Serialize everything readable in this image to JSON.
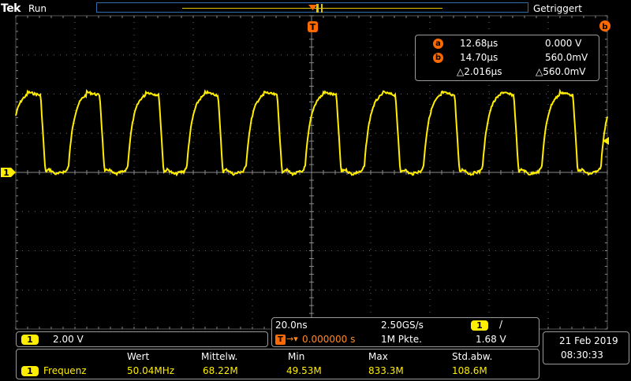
{
  "header": {
    "brand": "Tek",
    "run_state": "Run",
    "trigger_state": "Getriggert"
  },
  "markers": {
    "trigger_marker": "T",
    "cursor_a_marker": "a",
    "cursor_b_marker": "b",
    "channel_marker": "1"
  },
  "cursors": {
    "a_label": "a",
    "a_time": "12.68µs",
    "a_value": "0.000 V",
    "b_label": "b",
    "b_time": "14.70µs",
    "b_value": "560.0mV",
    "delta_time": "△2.016µs",
    "delta_value": "△560.0mV"
  },
  "channel": {
    "number": "1",
    "scale": "2.00 V",
    "color": "#ffee00"
  },
  "timebase": {
    "time_per_div": "20.0ns",
    "sample_rate": "2.50GS/s",
    "trigger_position": "0.000000 s",
    "record_length": "1M Pkte.",
    "trigger_source": "1",
    "trigger_slope": "/",
    "trigger_level": "1.68 V"
  },
  "datetime": {
    "date": "21 Feb  2019",
    "time": "08:30:33"
  },
  "measurements": {
    "headers": [
      "Wert",
      "Mittelw.",
      "Min",
      "Max",
      "Std.abw."
    ],
    "channel": "1",
    "name": "Frequenz",
    "values": [
      "50.04MHz",
      "68.22M",
      "49.53M",
      "833.3M",
      "108.6M"
    ]
  },
  "chart_data": {
    "type": "line",
    "xlabel": "",
    "ylabel": "",
    "x_divisions": 10,
    "y_divisions": 8,
    "grid": true,
    "series": [
      {
        "periods": 10,
        "high_volts": 4.1,
        "low_volts": 0.0
      }
    ]
  }
}
